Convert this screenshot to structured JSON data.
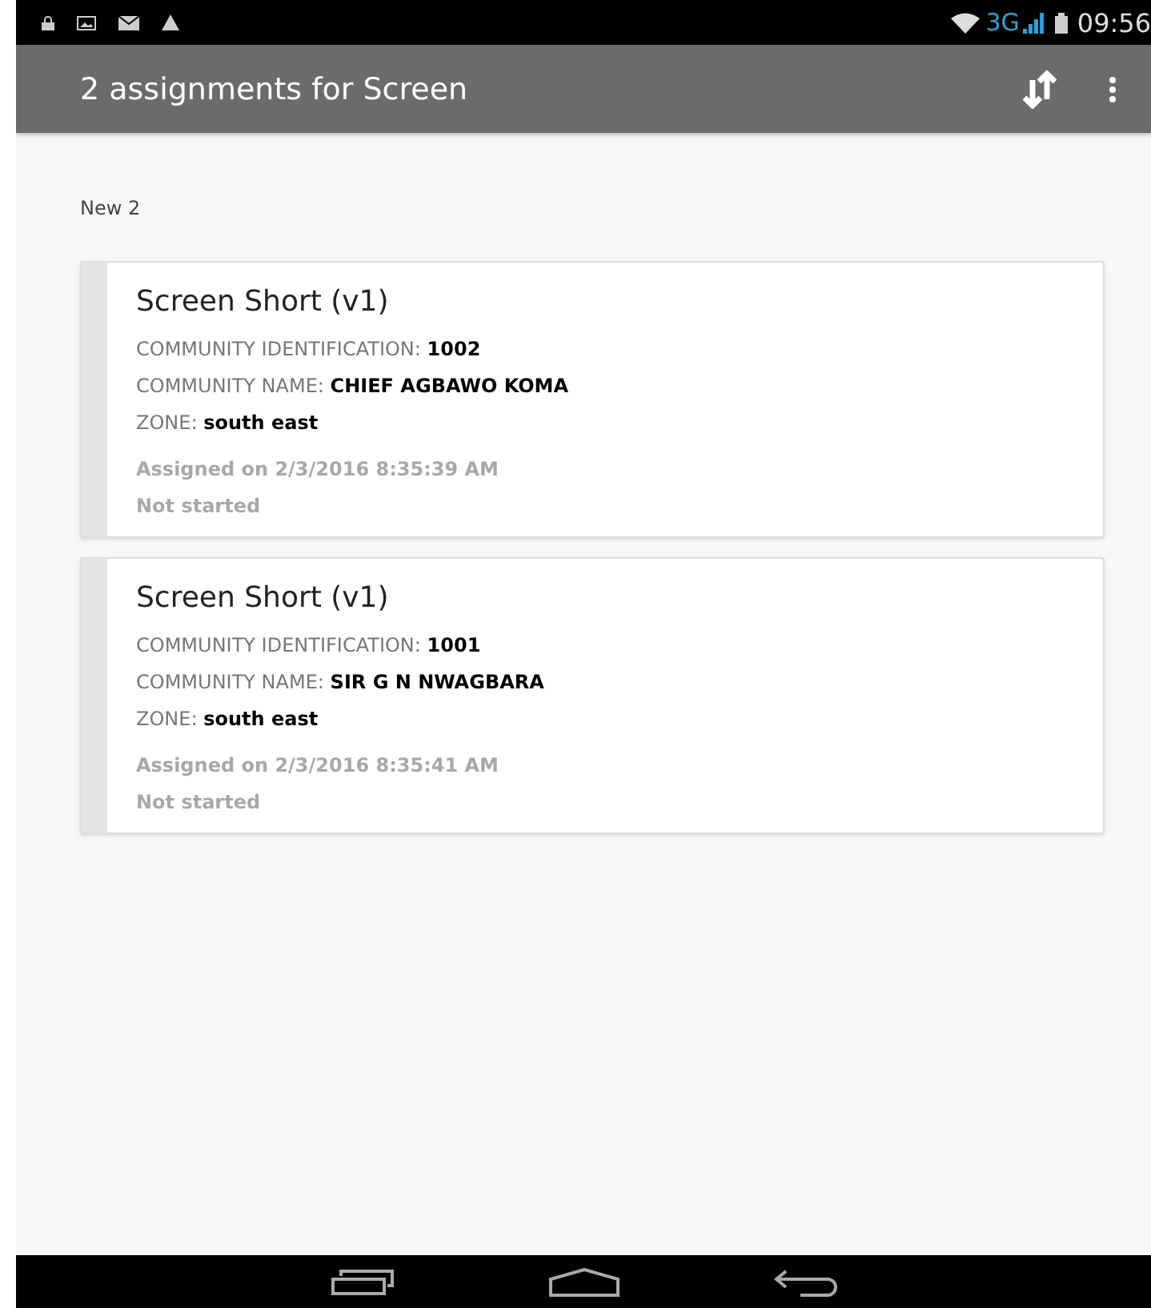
{
  "status_bar": {
    "network": "3G",
    "time": "09:56"
  },
  "toolbar": {
    "title": "2 assignments for Screen"
  },
  "section": {
    "header": "New 2"
  },
  "assignments": [
    {
      "title": "Screen Short (v1)",
      "fields": [
        {
          "label": "COMMUNITY IDENTIFICATION:",
          "value": "1002"
        },
        {
          "label": "COMMUNITY NAME:",
          "value": "CHIEF AGBAWO KOMA"
        },
        {
          "label": "ZONE:",
          "value": "south east"
        }
      ],
      "assigned": "Assigned on 2/3/2016 8:35:39 AM",
      "status": "Not started"
    },
    {
      "title": "Screen Short (v1)",
      "fields": [
        {
          "label": "COMMUNITY IDENTIFICATION:",
          "value": "1001"
        },
        {
          "label": "COMMUNITY NAME:",
          "value": "SIR G N NWAGBARA"
        },
        {
          "label": "ZONE:",
          "value": "south east"
        }
      ],
      "assigned": "Assigned on 2/3/2016 8:35:41 AM",
      "status": "Not started"
    }
  ]
}
